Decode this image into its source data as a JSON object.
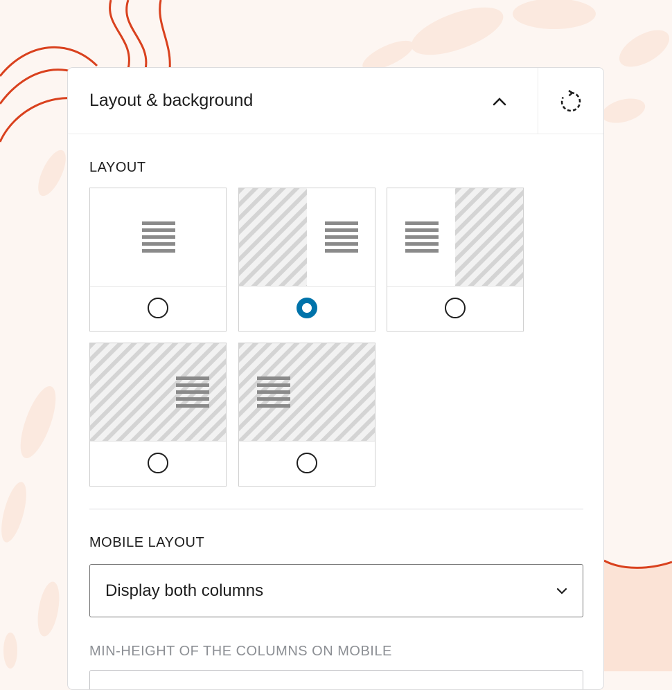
{
  "panel": {
    "title": "Layout & background",
    "collapse_icon": "chevron-up-icon",
    "reset_icon": "rotate-reset-icon"
  },
  "layout_section": {
    "label": "LAYOUT",
    "selected_index": 1,
    "options": [
      {
        "id": "text-only",
        "icon": "text-lines-icon"
      },
      {
        "id": "image-left-text-right",
        "icon": "text-lines-icon"
      },
      {
        "id": "text-left-image-right",
        "icon": "text-lines-icon"
      },
      {
        "id": "image-background-text-right",
        "icon": "text-lines-icon"
      },
      {
        "id": "image-background-text-left",
        "icon": "text-lines-icon"
      }
    ]
  },
  "mobile_layout": {
    "label": "MOBILE LAYOUT",
    "selected_value": "Display both columns",
    "chevron_icon": "chevron-down-icon"
  },
  "min_height": {
    "label": "MIN-HEIGHT OF THE COLUMNS ON MOBILE"
  },
  "colors": {
    "accent": "#0073aa",
    "decor_stroke": "#d9411e",
    "page_background": "#fdf6f2"
  }
}
